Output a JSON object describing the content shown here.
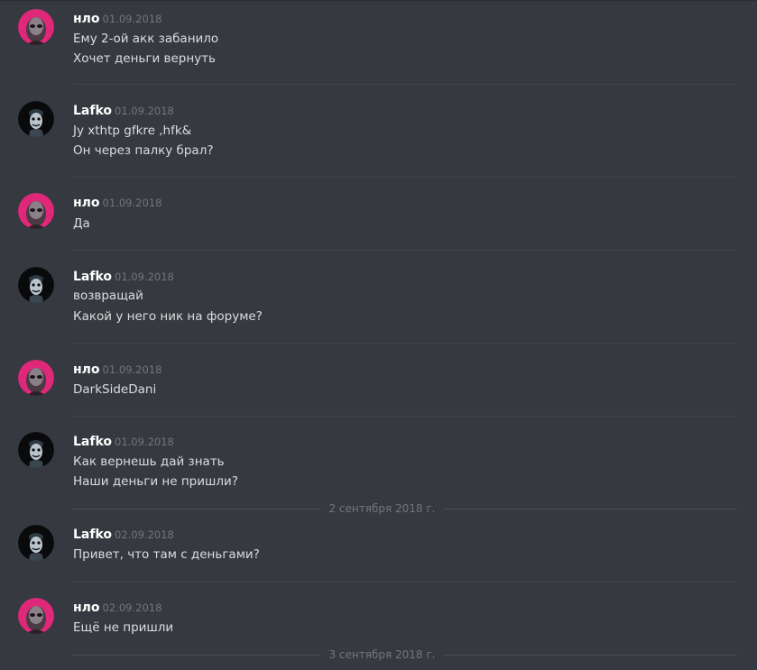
{
  "users": {
    "nlo": {
      "name": "нло",
      "avatar_icon": "alien-icon",
      "avatar_color": "#e0287a"
    },
    "lafko": {
      "name": "Lafko",
      "avatar_icon": "joker-icon",
      "avatar_color": "#0a0a0c"
    }
  },
  "messages": [
    {
      "author": "нло",
      "time": "01.09.2018",
      "lines": [
        "Ему 2-ой акк забанило",
        "Хочет деньги вернуть"
      ]
    },
    {
      "author": "Lafko",
      "time": "01.09.2018",
      "lines": [
        "Jy xthtp gfkre ,hfk&",
        "Он через палку брал?"
      ]
    },
    {
      "author": "нло",
      "time": "01.09.2018",
      "lines": [
        "Да"
      ]
    },
    {
      "author": "Lafko",
      "time": "01.09.2018",
      "lines": [
        "возвращай",
        "Какой у него ник на форуме?"
      ]
    },
    {
      "author": "нло",
      "time": "01.09.2018",
      "lines": [
        "DarkSideDani"
      ]
    },
    {
      "author": "Lafko",
      "time": "01.09.2018",
      "lines": [
        "Как вернешь дай знать",
        "Наши деньги не пришли?"
      ]
    },
    {
      "author": "Lafko",
      "time": "02.09.2018",
      "lines": [
        "Привет, что там с деньгами?"
      ]
    },
    {
      "author": "нло",
      "time": "02.09.2018",
      "lines": [
        "Ещё не пришли"
      ]
    }
  ],
  "day_dividers": [
    "2 сентября 2018 г.",
    "3 сентября 2018 г."
  ]
}
